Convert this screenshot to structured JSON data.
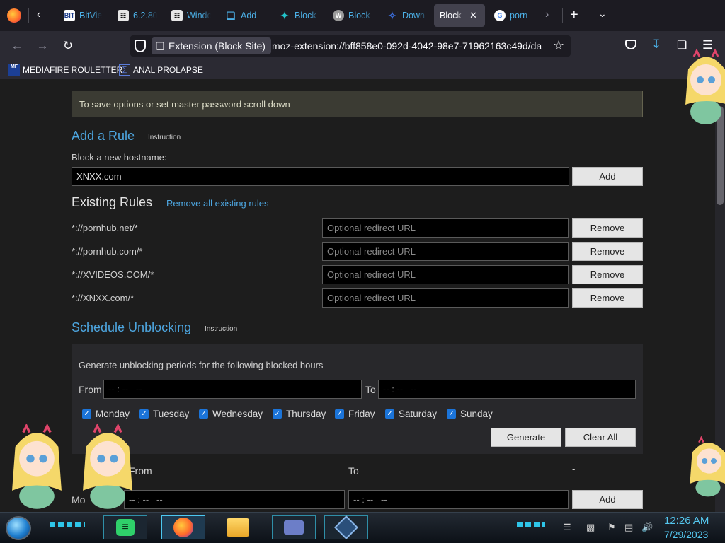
{
  "tabs": [
    {
      "label": "BitVie",
      "favicon": "BIT",
      "color": "#4cb1e8"
    },
    {
      "label": "6.2.80",
      "favicon": "archive-icon",
      "color": "#4cb1e8"
    },
    {
      "label": "Windo",
      "favicon": "archive-icon",
      "color": "#4cb1e8"
    },
    {
      "label": "Add-",
      "favicon": "puzzle-icon",
      "color": "#4cb1e8"
    },
    {
      "label": "Block",
      "favicon": "puzzle-icon",
      "color": "#4cb1e8"
    },
    {
      "label": "Block",
      "favicon": "W",
      "color": "#4cb1e8"
    },
    {
      "label": "Down",
      "favicon": "download-icon",
      "color": "#4cb1e8"
    },
    {
      "label": "Block",
      "favicon": "",
      "color": "#fbfbfe",
      "active": true
    },
    {
      "label": "porn",
      "favicon": "G",
      "color": "#4cb1e8"
    }
  ],
  "urlbar": {
    "extension_chip": "Extension (Block Site)",
    "url": "moz-extension://bff858e0-092d-4042-98e7-71962163c49d/da"
  },
  "bookmarks": [
    {
      "label": "MEDIAFIRE ROULETTER",
      "icon": "MF"
    },
    {
      "label": "ANAL PROLAPSE",
      "icon": "bookmark-icon"
    }
  ],
  "notice": "To save options or set master password scroll down",
  "add_rule": {
    "heading": "Add a Rule",
    "instruction": "Instruction",
    "label": "Block a new hostname:",
    "value": "XNXX.com",
    "button": "Add"
  },
  "existing": {
    "heading": "Existing Rules",
    "remove_all": "Remove all existing rules",
    "placeholder": "Optional redirect URL",
    "remove_label": "Remove",
    "rules": [
      "*://pornhub.net/*",
      "*://pornhub.com/*",
      "*://XVIDEOS.COM/*",
      "*://XNXX.com/*"
    ]
  },
  "schedule": {
    "heading": "Schedule Unblocking",
    "instruction": "Instruction",
    "description": "Generate unblocking periods for the following blocked hours",
    "from_label": "From",
    "to_label": "To",
    "time_placeholder": "-- : --   --",
    "days": [
      "Monday",
      "Tuesday",
      "Wednesday",
      "Thursday",
      "Friday",
      "Saturday",
      "Sunday"
    ],
    "generate": "Generate",
    "clear_all": "Clear All"
  },
  "periods": {
    "from_label": "From",
    "to_label": "To",
    "dash": "-",
    "day_partial": "Mo",
    "time_placeholder": "-- : --   --",
    "add": "Add"
  },
  "clock": {
    "time": "12:26 AM",
    "date": "7/29/2023"
  },
  "colors": {
    "accent": "#4da6e0",
    "checkbox": "#1b74d9",
    "clock": "#55c8f0"
  }
}
